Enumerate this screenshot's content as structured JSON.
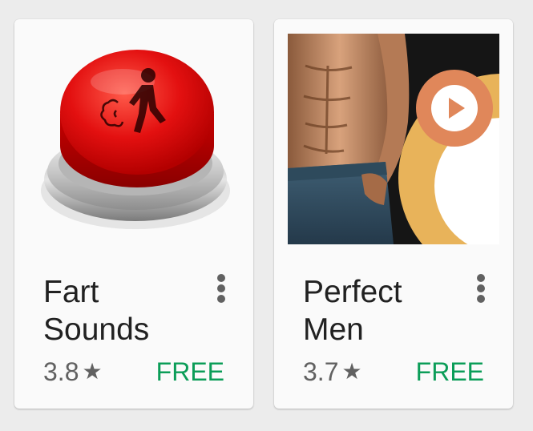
{
  "apps": [
    {
      "title": "Fart\nSounds",
      "rating": "3.8",
      "price": "FREE",
      "icon": "red-push-button-icon"
    },
    {
      "title": "Perfect\nMen",
      "rating": "3.7",
      "price": "FREE",
      "icon": "fitness-man-play-icon"
    }
  ],
  "rating_star": "★",
  "colors": {
    "price": "#0b9d58",
    "card_background": "#fafafa",
    "page_background": "#ececec",
    "text": "#212121",
    "secondary_text": "#616161"
  }
}
